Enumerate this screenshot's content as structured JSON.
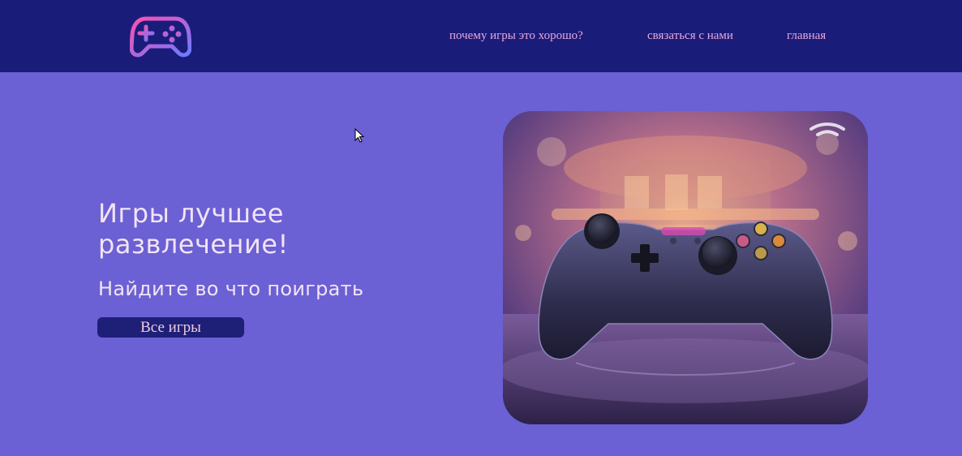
{
  "header": {
    "logo_icon": "gamepad-icon",
    "nav": [
      {
        "label": "почему игры это хорошо?"
      },
      {
        "label": "связаться с нами"
      },
      {
        "label": "главная"
      }
    ]
  },
  "hero": {
    "title": "Игры лучшее развлечение!",
    "subtitle": "Найдите во что поиграть",
    "button_label": "Все игры",
    "image_icon": "game-controller-image"
  },
  "colors": {
    "header_bg": "#1a1c7a",
    "page_bg": "#6b60d4",
    "nav_text": "#e8a8d8",
    "button_bg": "#1e2078",
    "heading_text": "#f2e4f4"
  }
}
